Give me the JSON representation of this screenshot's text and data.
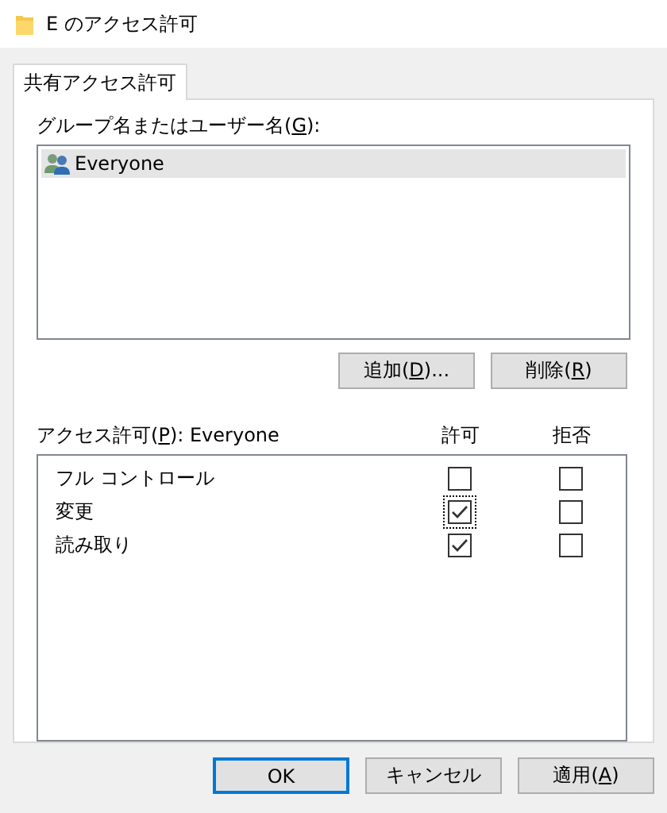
{
  "window": {
    "title": "E のアクセス許可"
  },
  "tabs": [
    {
      "label": "共有アクセス許可",
      "selected": true
    }
  ],
  "group_label": {
    "before": "グループ名またはユーザー名(",
    "key": "G",
    "after": "):"
  },
  "users": [
    {
      "name": "Everyone",
      "selected": true
    }
  ],
  "user_buttons": [
    {
      "before": "追加(",
      "key": "D",
      "after": ")..."
    },
    {
      "before": "削除(",
      "key": "R",
      "after": ")"
    }
  ],
  "permissions": {
    "label": {
      "before": "アクセス許可(",
      "key": "P",
      "after": "): Everyone"
    },
    "columns": [
      "許可",
      "拒否"
    ],
    "rows": [
      {
        "name": "フル コントロール",
        "allow": {
          "checked": false,
          "focused": false
        },
        "deny": {
          "checked": false,
          "focused": false
        }
      },
      {
        "name": "変更",
        "allow": {
          "checked": true,
          "focused": true
        },
        "deny": {
          "checked": false,
          "focused": false
        }
      },
      {
        "name": "読み取り",
        "allow": {
          "checked": true,
          "focused": false
        },
        "deny": {
          "checked": false,
          "focused": false
        }
      }
    ]
  },
  "buttons": [
    {
      "label": {
        "before": "OK"
      },
      "default": true
    },
    {
      "label": {
        "before": "キャンセル"
      },
      "default": false
    },
    {
      "label": {
        "before": "適用(",
        "key": "A",
        "after": ")"
      },
      "default": false
    }
  ]
}
